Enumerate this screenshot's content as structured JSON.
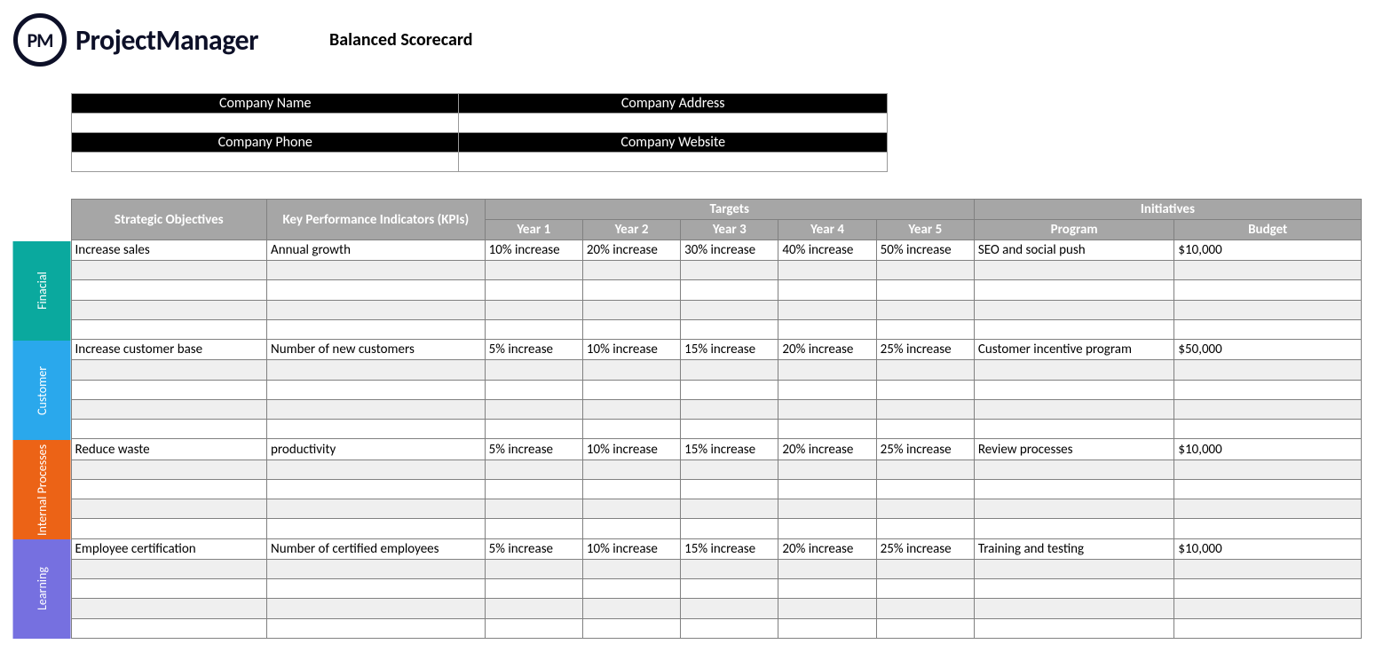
{
  "header": {
    "logo_abbrev": "PM",
    "logo_text": "ProjectManager",
    "doc_title": "Balanced Scorecard"
  },
  "company": {
    "name_label": "Company Name",
    "address_label": "Company Address",
    "phone_label": "Company Phone",
    "website_label": "Company Website",
    "name": "",
    "address": "",
    "phone": "",
    "website": ""
  },
  "columns": {
    "objectives": "Strategic Objectives",
    "kpis": "Key Performance Indicators (KPIs)",
    "targets": "Targets",
    "initiatives": "Initiatives",
    "years": [
      "Year 1",
      "Year 2",
      "Year 3",
      "Year 4",
      "Year 5"
    ],
    "program": "Program",
    "budget": "Budget"
  },
  "sections": [
    {
      "label": "Finacial",
      "rows": [
        {
          "objective": "Increase sales",
          "kpi": "Annual growth",
          "targets": [
            "10% increase",
            "20% increase",
            "30% increase",
            "40% increase",
            "50% increase"
          ],
          "program": "SEO and social push",
          "budget": "$10,000"
        },
        {
          "objective": "",
          "kpi": "",
          "targets": [
            "",
            "",
            "",
            "",
            ""
          ],
          "program": "",
          "budget": ""
        },
        {
          "objective": "",
          "kpi": "",
          "targets": [
            "",
            "",
            "",
            "",
            ""
          ],
          "program": "",
          "budget": ""
        },
        {
          "objective": "",
          "kpi": "",
          "targets": [
            "",
            "",
            "",
            "",
            ""
          ],
          "program": "",
          "budget": ""
        },
        {
          "objective": "",
          "kpi": "",
          "targets": [
            "",
            "",
            "",
            "",
            ""
          ],
          "program": "",
          "budget": ""
        }
      ]
    },
    {
      "label": "Customer",
      "rows": [
        {
          "objective": "Increase customer base",
          "kpi": "Number of new customers",
          "targets": [
            "5% increase",
            "10% increase",
            "15% increase",
            "20% increase",
            "25% increase"
          ],
          "program": "Customer incentive program",
          "budget": "$50,000"
        },
        {
          "objective": "",
          "kpi": "",
          "targets": [
            "",
            "",
            "",
            "",
            ""
          ],
          "program": "",
          "budget": ""
        },
        {
          "objective": "",
          "kpi": "",
          "targets": [
            "",
            "",
            "",
            "",
            ""
          ],
          "program": "",
          "budget": ""
        },
        {
          "objective": "",
          "kpi": "",
          "targets": [
            "",
            "",
            "",
            "",
            ""
          ],
          "program": "",
          "budget": ""
        },
        {
          "objective": "",
          "kpi": "",
          "targets": [
            "",
            "",
            "",
            "",
            ""
          ],
          "program": "",
          "budget": ""
        }
      ]
    },
    {
      "label": "Internal Processes",
      "rows": [
        {
          "objective": "Reduce waste",
          "kpi": "productivity",
          "targets": [
            "5% increase",
            "10% increase",
            "15% increase",
            "20% increase",
            "25% increase"
          ],
          "program": "Review processes",
          "budget": "$10,000"
        },
        {
          "objective": "",
          "kpi": "",
          "targets": [
            "",
            "",
            "",
            "",
            ""
          ],
          "program": "",
          "budget": ""
        },
        {
          "objective": "",
          "kpi": "",
          "targets": [
            "",
            "",
            "",
            "",
            ""
          ],
          "program": "",
          "budget": ""
        },
        {
          "objective": "",
          "kpi": "",
          "targets": [
            "",
            "",
            "",
            "",
            ""
          ],
          "program": "",
          "budget": ""
        },
        {
          "objective": "",
          "kpi": "",
          "targets": [
            "",
            "",
            "",
            "",
            ""
          ],
          "program": "",
          "budget": ""
        }
      ]
    },
    {
      "label": "Learning",
      "rows": [
        {
          "objective": "Employee certification",
          "kpi": "Number of certified employees",
          "targets": [
            "5% increase",
            "10% increase",
            "15% increase",
            "20% increase",
            "25% increase"
          ],
          "program": "Training and testing",
          "budget": "$10,000"
        },
        {
          "objective": "",
          "kpi": "",
          "targets": [
            "",
            "",
            "",
            "",
            ""
          ],
          "program": "",
          "budget": ""
        },
        {
          "objective": "",
          "kpi": "",
          "targets": [
            "",
            "",
            "",
            "",
            ""
          ],
          "program": "",
          "budget": ""
        },
        {
          "objective": "",
          "kpi": "",
          "targets": [
            "",
            "",
            "",
            "",
            ""
          ],
          "program": "",
          "budget": ""
        },
        {
          "objective": "",
          "kpi": "",
          "targets": [
            "",
            "",
            "",
            "",
            ""
          ],
          "program": "",
          "budget": ""
        }
      ]
    }
  ]
}
